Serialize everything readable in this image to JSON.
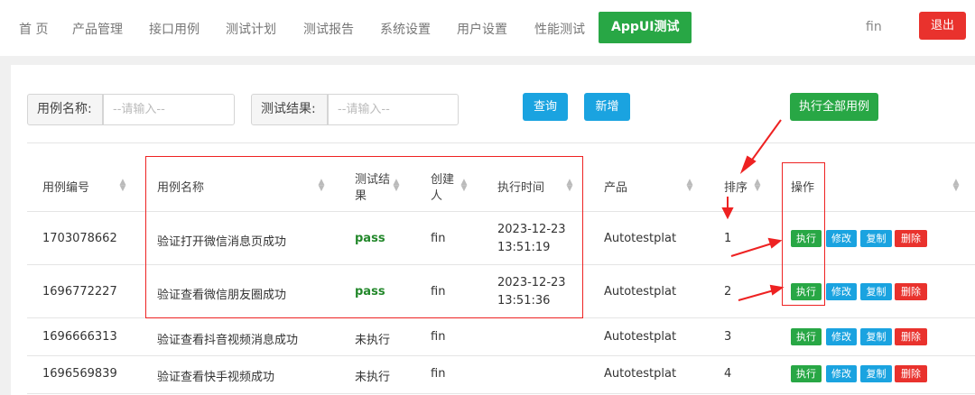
{
  "nav": {
    "items": [
      "首 页",
      "产品管理",
      "接口用例",
      "测试计划",
      "测试报告",
      "系统设置",
      "用户设置",
      "性能测试"
    ],
    "active_label": "AppUI测试",
    "user": "fin",
    "logout_label": "退出"
  },
  "filters": {
    "case_name_label": "用例名称:",
    "case_name_placeholder": "--请输入--",
    "result_label": "测试结果:",
    "result_placeholder": "--请输入--",
    "query_label": "查询",
    "add_label": "新增",
    "run_all_label": "执行全部用例"
  },
  "table": {
    "headers": {
      "id": "用例编号",
      "name": "用例名称",
      "result_line1": "测试结",
      "result_line2": "果",
      "creator_line1": "创建",
      "creator_line2": "人",
      "exec_time": "执行时间",
      "product": "产品",
      "order": "排序",
      "actions": "操作"
    },
    "action_labels": {
      "exec": "执行",
      "edit": "修改",
      "copy": "复制",
      "delete": "删除"
    },
    "rows": [
      {
        "id": "1703078662",
        "name": "验证打开微信消息页成功",
        "result": "pass",
        "creator": "fin",
        "date": "2023-12-23",
        "time": "13:51:19",
        "product": "Autotestplat",
        "order": "1"
      },
      {
        "id": "1696772227",
        "name": "验证查看微信朋友圈成功",
        "result": "pass",
        "creator": "fin",
        "date": "2023-12-23",
        "time": "13:51:36",
        "product": "Autotestplat",
        "order": "2"
      },
      {
        "id": "1696666313",
        "name": "验证查看抖音视频消息成功",
        "result": "未执行",
        "creator": "fin",
        "date": "",
        "time": "",
        "product": "Autotestplat",
        "order": "3"
      },
      {
        "id": "1696569839",
        "name": "验证查看快手视频成功",
        "result": "未执行",
        "creator": "fin",
        "date": "",
        "time": "",
        "product": "Autotestplat",
        "order": "4"
      }
    ]
  },
  "colors": {
    "accent_green": "#28a745",
    "accent_blue": "#1aa3e0",
    "danger_red": "#e9322d",
    "annotation_red": "#e22"
  }
}
